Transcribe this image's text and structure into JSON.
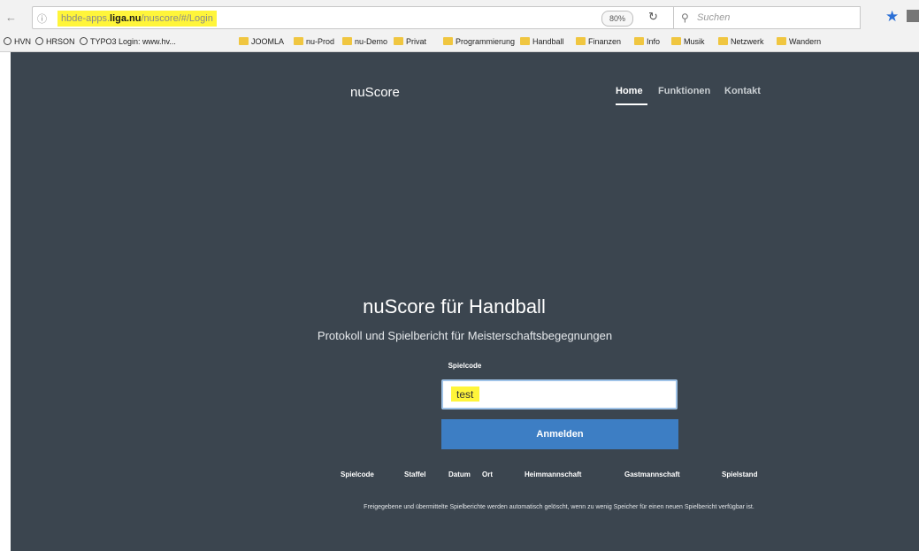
{
  "browser": {
    "back_icon": "back-arrow-icon",
    "info_icon": "info-icon",
    "url_prefix": "hbde-apps.",
    "url_host": "liga.nu",
    "url_path": "/nuscore/#/Login",
    "zoom": "80%",
    "search_placeholder": "Suchen",
    "bookmarks": [
      {
        "label": "HVN",
        "type": "globe"
      },
      {
        "label": "HRSON",
        "type": "globe"
      },
      {
        "label": "TYPO3 Login: www.hv...",
        "type": "globe"
      },
      {
        "label": "JOOMLA",
        "type": "folder"
      },
      {
        "label": "nu-Prod",
        "type": "folder"
      },
      {
        "label": "nu-Demo",
        "type": "folder"
      },
      {
        "label": "Privat",
        "type": "folder"
      },
      {
        "label": "Programmierung",
        "type": "folder"
      },
      {
        "label": "Handball",
        "type": "folder"
      },
      {
        "label": "Finanzen",
        "type": "folder"
      },
      {
        "label": "Info",
        "type": "folder"
      },
      {
        "label": "Musik",
        "type": "folder"
      },
      {
        "label": "Netzwerk",
        "type": "folder"
      },
      {
        "label": "Wandern",
        "type": "folder"
      }
    ]
  },
  "site": {
    "brand": "nuScore",
    "nav": [
      "Home",
      "Funktionen",
      "Kontakt"
    ],
    "active_nav": "Home"
  },
  "hero": {
    "title": "nuScore für Handball",
    "subtitle": "Protokoll und Spielbericht für Meisterschaftsbegegnungen"
  },
  "login": {
    "label": "Spielcode",
    "value": "test",
    "button": "Anmelden"
  },
  "columns": [
    "Spielcode",
    "Staffel",
    "Datum",
    "Ort",
    "Heimmannschaft",
    "Gastmannschaft",
    "Spielstand"
  ],
  "info_text": "Freigegebene und übermittelte Spielberichte werden automatisch gelöscht, wenn zu wenig Speicher für einen neuen Spielbericht verfügbar ist.",
  "colors": {
    "page_bg": "#3b454f",
    "button": "#3d7ec4",
    "highlight": "#fff53a",
    "star": "#2a6fd6"
  }
}
